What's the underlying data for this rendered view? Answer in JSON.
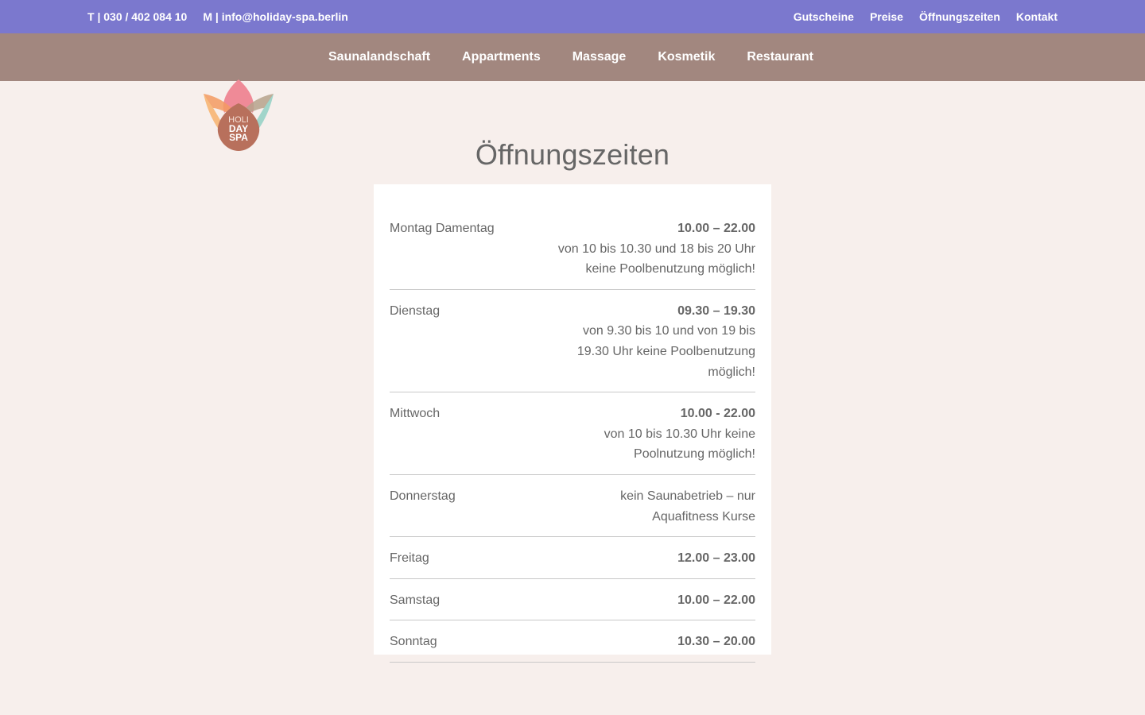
{
  "topbar": {
    "phone": "T | 030 / 402 084 10",
    "email": "M | info@holiday-spa.berlin",
    "links": [
      "Gutscheine",
      "Preise",
      "Öffnungszeiten",
      "Kontakt"
    ]
  },
  "logo": {
    "line1": "HOLI",
    "line2": "DAY",
    "line3": "SPA"
  },
  "nav": {
    "items": [
      "Saunalandschaft",
      "Appartments",
      "Massage",
      "Kosmetik",
      "Restaurant"
    ]
  },
  "page": {
    "title": "Öffnungszeiten"
  },
  "hours": [
    {
      "day": "Montag Damentag",
      "time": "10.00 – 22.00",
      "note": "von 10 bis 10.30 und 18 bis 20 Uhr keine Poolbenutzung möglich!"
    },
    {
      "day": "Dienstag",
      "time": "09.30 – 19.30",
      "note": "von 9.30 bis 10 und von 19 bis 19.30 Uhr keine Poolbenutzung möglich!"
    },
    {
      "day": "Mittwoch",
      "time": "10.00 - 22.00",
      "note": "von 10 bis 10.30 Uhr keine Poolnutzung möglich!"
    },
    {
      "day": "Donnerstag",
      "time": "",
      "note": "kein Saunabetrieb – nur Aquafitness Kurse"
    },
    {
      "day": "Freitag",
      "time": "12.00 – 23.00",
      "note": ""
    },
    {
      "day": "Samstag",
      "time": "10.00 – 22.00",
      "note": ""
    },
    {
      "day": "Sonntag",
      "time": "10.30 – 20.00",
      "note": ""
    }
  ],
  "colors": {
    "topbar": "#7b78ce",
    "mainbar": "#a2877f",
    "background": "#f7efec",
    "card": "#ffffff",
    "text": "#666666"
  }
}
